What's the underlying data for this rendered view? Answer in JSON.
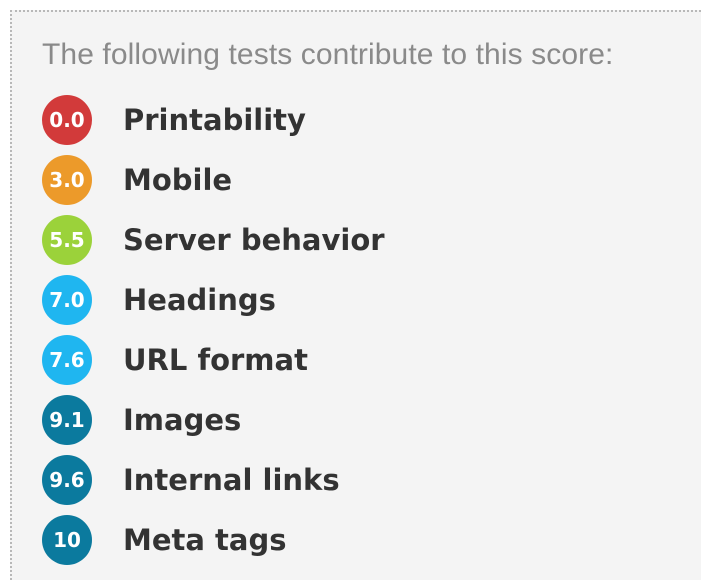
{
  "intro_text": "The following tests contribute to this score:",
  "tests": [
    {
      "score": "0.0",
      "name": "Printability",
      "color": "#d23a3a"
    },
    {
      "score": "3.0",
      "name": "Mobile",
      "color": "#ec9a2a"
    },
    {
      "score": "5.5",
      "name": "Server behavior",
      "color": "#9bd23a"
    },
    {
      "score": "7.0",
      "name": "Headings",
      "color": "#1fb6f0"
    },
    {
      "score": "7.6",
      "name": "URL format",
      "color": "#1fb6f0"
    },
    {
      "score": "9.1",
      "name": "Images",
      "color": "#0b7a9e"
    },
    {
      "score": "9.6",
      "name": "Internal links",
      "color": "#0b7a9e"
    },
    {
      "score": "10",
      "name": "Meta tags",
      "color": "#0b7a9e"
    }
  ]
}
